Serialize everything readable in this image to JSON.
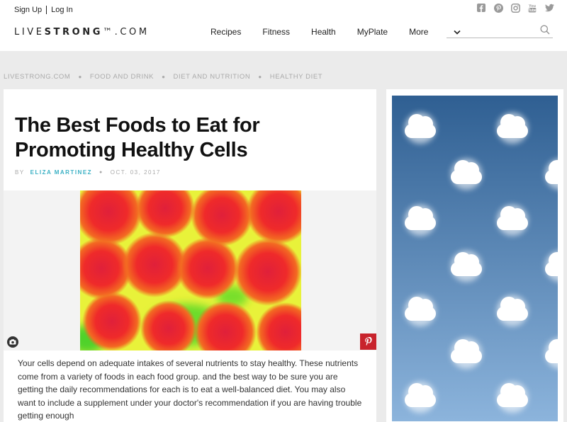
{
  "header": {
    "sign_up": "Sign Up",
    "log_in": "Log In",
    "logo_light_1": "LIVE",
    "logo_bold": "STRONG",
    "logo_light_2": "™.COM",
    "nav": [
      "Recipes",
      "Fitness",
      "Health",
      "MyPlate",
      "More"
    ],
    "search_placeholder": "",
    "social_icons": [
      "facebook-icon",
      "pinterest-icon",
      "instagram-icon",
      "youtube-icon",
      "twitter-icon"
    ]
  },
  "breadcrumb": [
    "LIVESTRONG.COM",
    "FOOD AND DRINK",
    "DIET AND NUTRITION",
    "HEALTHY DIET"
  ],
  "article": {
    "title": "The Best Foods to Eat for Promoting Healthy Cells",
    "by": "BY",
    "author": "ELIZA MARTINEZ",
    "date": "OCT. 03, 2017",
    "body": "Your cells depend on adequate intakes of several nutrients to stay healthy. These nutrients come from a variety of foods in each food group. and the best way to be sure you are getting the daily recommendations for each is to eat a well-balanced diet. You may also want to include a supplement under your doctor's recommendation if you are having trouble getting enough"
  },
  "colors": {
    "accent": "#3ab0c4",
    "pinterest": "#c8232c",
    "sky_top": "#2f5f92",
    "sky_bottom": "#8cb4dc"
  }
}
